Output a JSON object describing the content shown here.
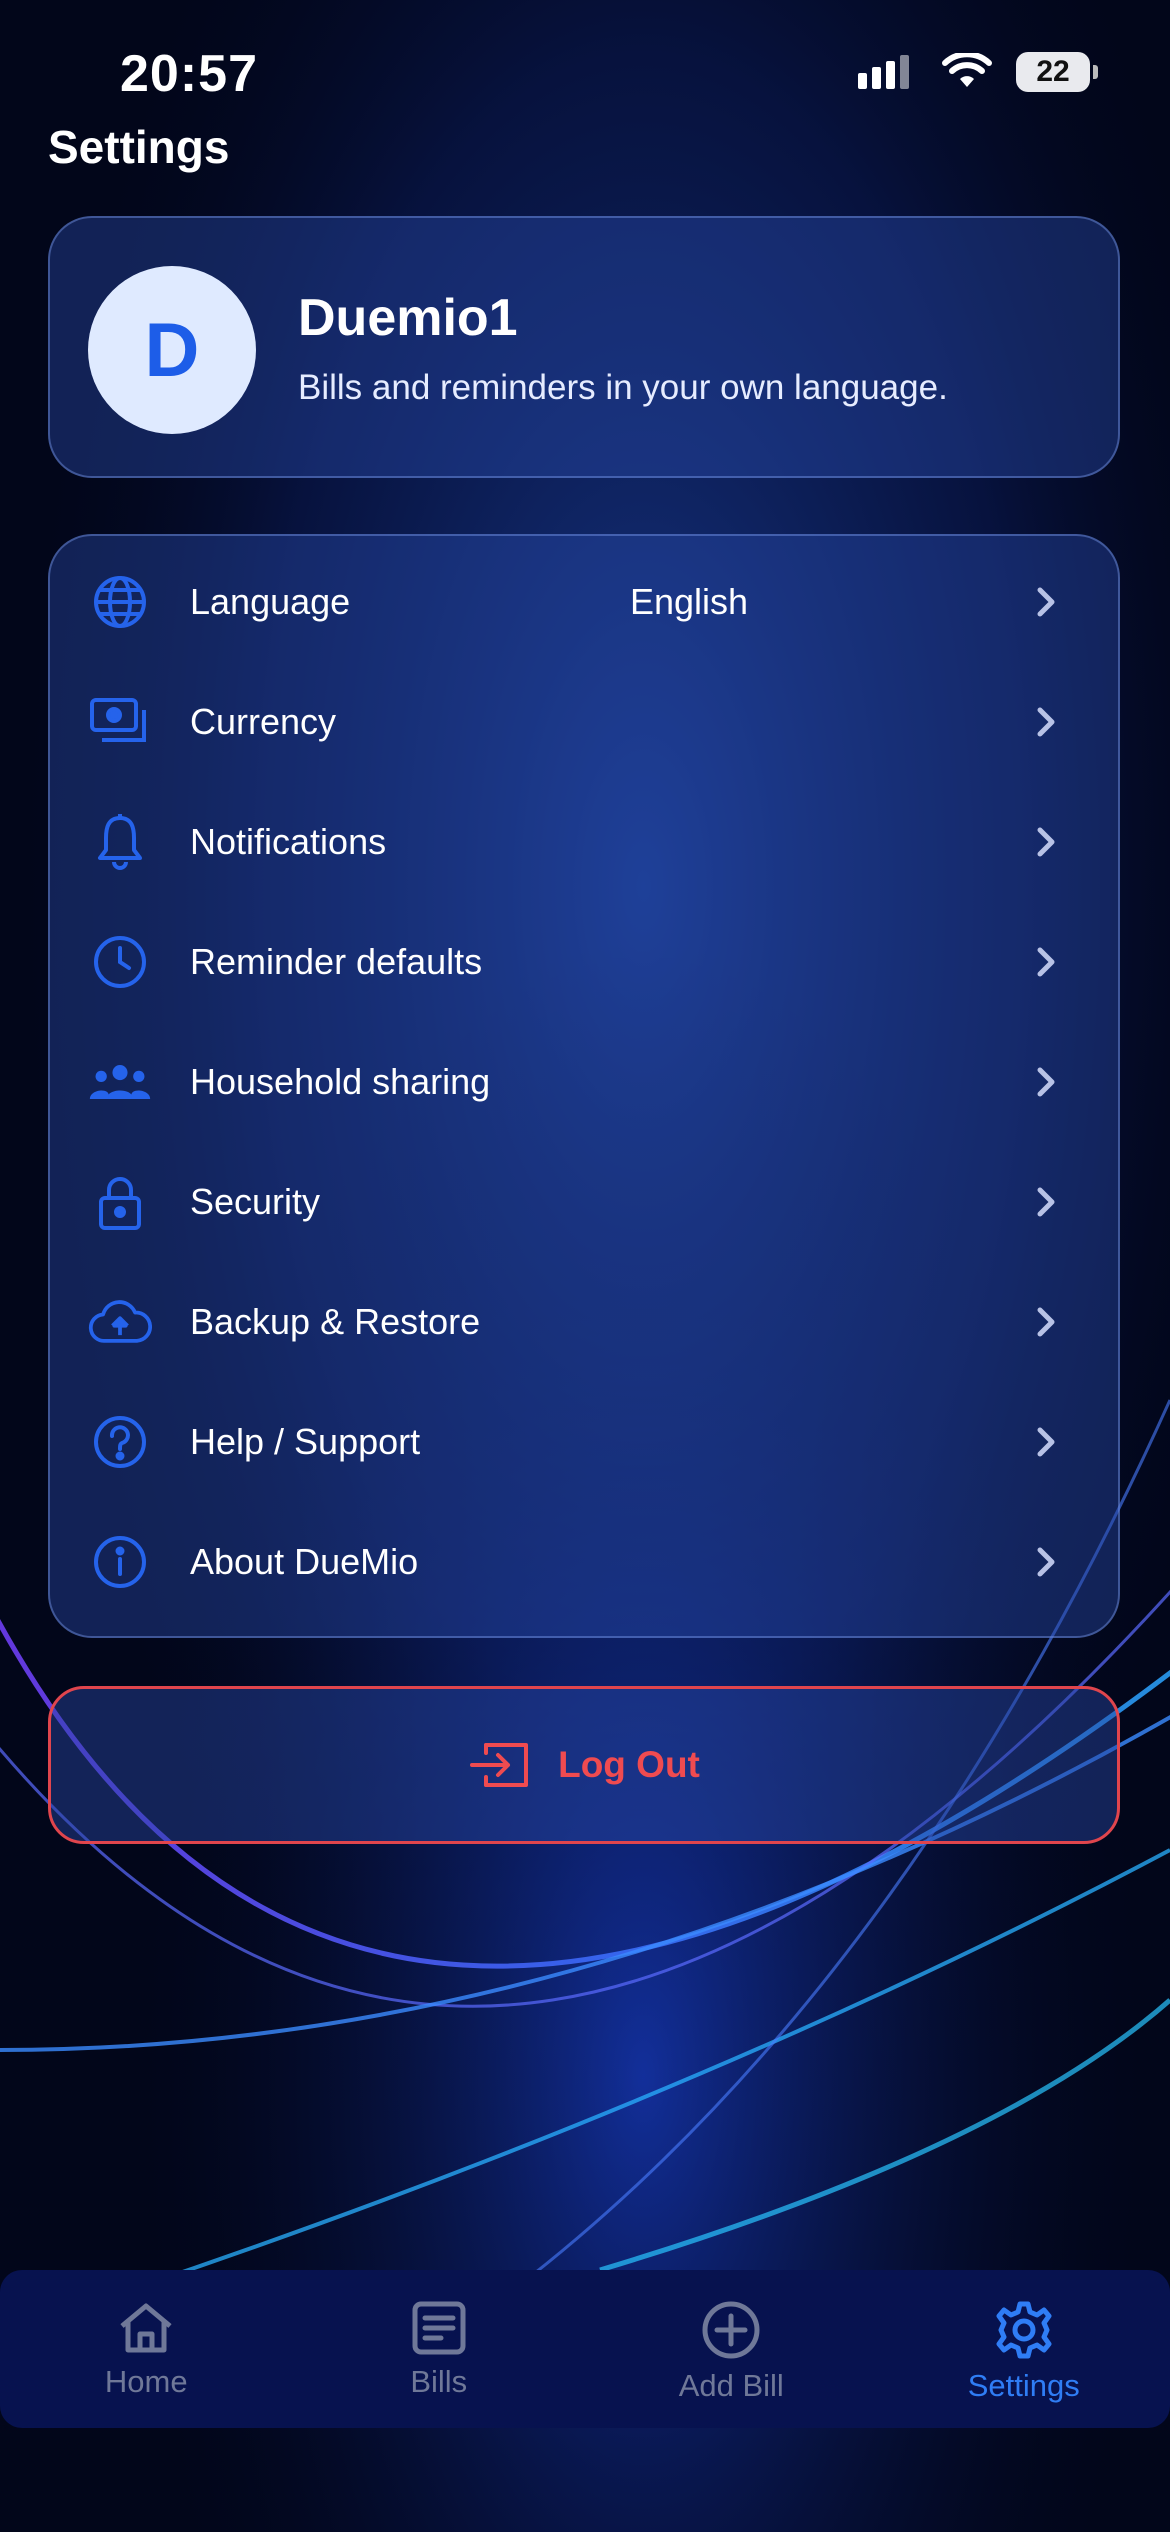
{
  "status_bar": {
    "time": "20:57",
    "battery": "22"
  },
  "page": {
    "title": "Settings"
  },
  "profile": {
    "avatar_initial": "D",
    "name": "Duemio1",
    "tagline": "Bills and reminders in your own language."
  },
  "menu": {
    "items": [
      {
        "label": "Language",
        "value": "English",
        "icon": "globe-icon"
      },
      {
        "label": "Currency",
        "value": "",
        "icon": "money-icon"
      },
      {
        "label": "Notifications",
        "value": "",
        "icon": "bell-icon"
      },
      {
        "label": "Reminder defaults",
        "value": "",
        "icon": "clock-icon"
      },
      {
        "label": "Household sharing",
        "value": "",
        "icon": "people-icon"
      },
      {
        "label": "Security",
        "value": "",
        "icon": "lock-icon"
      },
      {
        "label": "Backup & Restore",
        "value": "",
        "icon": "cloud-upload-icon"
      },
      {
        "label": "Help / Support",
        "value": "",
        "icon": "help-icon"
      },
      {
        "label": "About DueMio",
        "value": "",
        "icon": "info-icon"
      }
    ]
  },
  "logout": {
    "label": "Log Out",
    "icon": "logout-icon"
  },
  "tab_bar": {
    "tabs": [
      {
        "label": "Home",
        "icon": "home-icon",
        "active": false
      },
      {
        "label": "Bills",
        "icon": "bills-icon",
        "active": false
      },
      {
        "label": "Add Bill",
        "icon": "add-circle-icon",
        "active": false
      },
      {
        "label": "Settings",
        "icon": "gear-icon",
        "active": true
      }
    ]
  },
  "colors": {
    "accent": "#2f7df5",
    "icon_blue": "#2563eb",
    "danger": "#ef4b50",
    "background": "#02061a",
    "tab_inactive": "#6f7898"
  }
}
